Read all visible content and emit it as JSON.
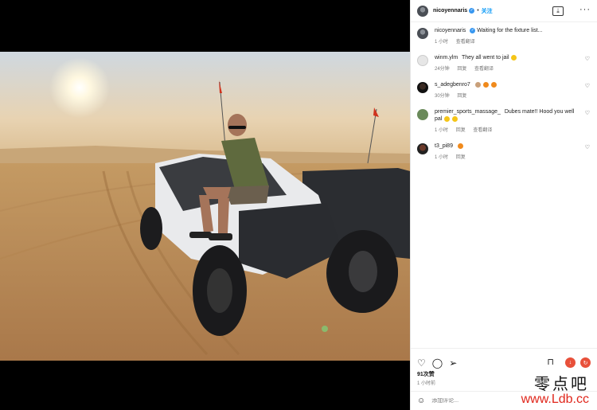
{
  "header": {
    "username": "nicoyennaris",
    "follow_label": "关注",
    "dot": "•"
  },
  "caption": {
    "username": "nicoyennaris",
    "text": "Waiting for the fixture list...",
    "time": "1 小时",
    "translate": "查看翻译"
  },
  "comments": [
    {
      "username": "winm.ylm",
      "text": "They all went to jail",
      "time": "24分钟",
      "reply": "回复",
      "translate": "查看翻译",
      "emoji_color": "#f5c518"
    },
    {
      "username": "s_adegbenro7",
      "text": "",
      "time": "30分钟",
      "reply": "回复",
      "translate": "",
      "emoji_color": "#e07a2c"
    },
    {
      "username": "premier_sports_massage_",
      "text": "Dubes mate!! Hood you well pal",
      "time": "1 小时",
      "reply": "回复",
      "translate": "查看翻译",
      "emoji_color": "#f5c518"
    },
    {
      "username": "t3_pi89",
      "text": "",
      "time": "1 小时",
      "reply": "回复",
      "translate": "",
      "emoji_color": "#f08a1c"
    }
  ],
  "stats": {
    "likes": "91次赞",
    "time": "1 小时前"
  },
  "composer": {
    "placeholder": "添加评论..."
  },
  "watermark": {
    "cn": "零点吧",
    "url": "www.Ldb.cc"
  },
  "colors": {
    "accent": "#0095f6",
    "download_btn": "#e8503a",
    "reload_btn": "#e8503a"
  },
  "icons": [
    "verified-icon",
    "download-icon",
    "more-icon",
    "heart-icon",
    "comment-icon",
    "share-icon",
    "bookmark-icon",
    "smile-icon"
  ]
}
